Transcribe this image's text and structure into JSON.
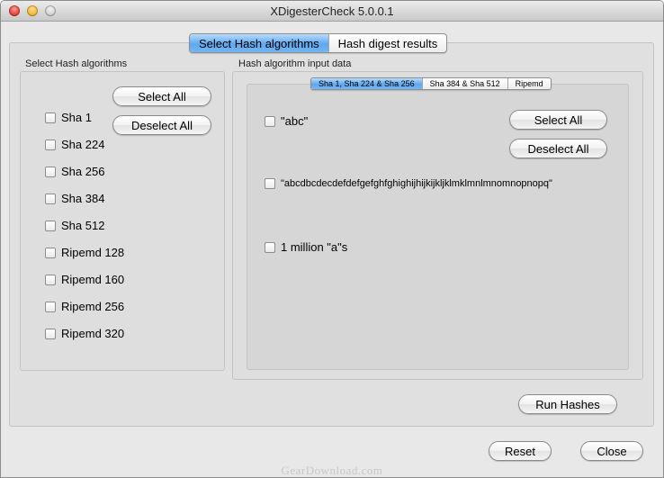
{
  "window": {
    "title": "XDigesterCheck 5.0.0.1"
  },
  "main_tabs": [
    {
      "label": "Select Hash algorithms",
      "selected": true
    },
    {
      "label": "Hash digest results",
      "selected": false
    }
  ],
  "left_panel": {
    "title": "Select Hash algorithms",
    "select_all": "Select All",
    "deselect_all": "Deselect All",
    "algorithms": [
      "Sha 1",
      "Sha 224",
      "Sha 256",
      "Sha 384",
      "Sha 512",
      "Ripemd 128",
      "Ripemd 160",
      "Ripemd 256",
      "Ripemd 320"
    ]
  },
  "right_panel": {
    "title": "Hash algorithm input data",
    "sub_tabs": [
      {
        "label": "Sha 1, Sha 224 & Sha 256",
        "selected": true
      },
      {
        "label": "Sha 384 & Sha 512",
        "selected": false
      },
      {
        "label": "Ripemd",
        "selected": false
      }
    ],
    "inputs": [
      "\"abc\"",
      "\"abcdbcdecdefdefgefghfghighijhijkijkljklmklmnlmnomnopnopq\"",
      "1 million \"a\"s"
    ],
    "select_all": "Select All",
    "deselect_all": "Deselect All"
  },
  "buttons": {
    "run": "Run Hashes",
    "reset": "Reset",
    "close": "Close"
  },
  "watermark": "GearDownload.com"
}
